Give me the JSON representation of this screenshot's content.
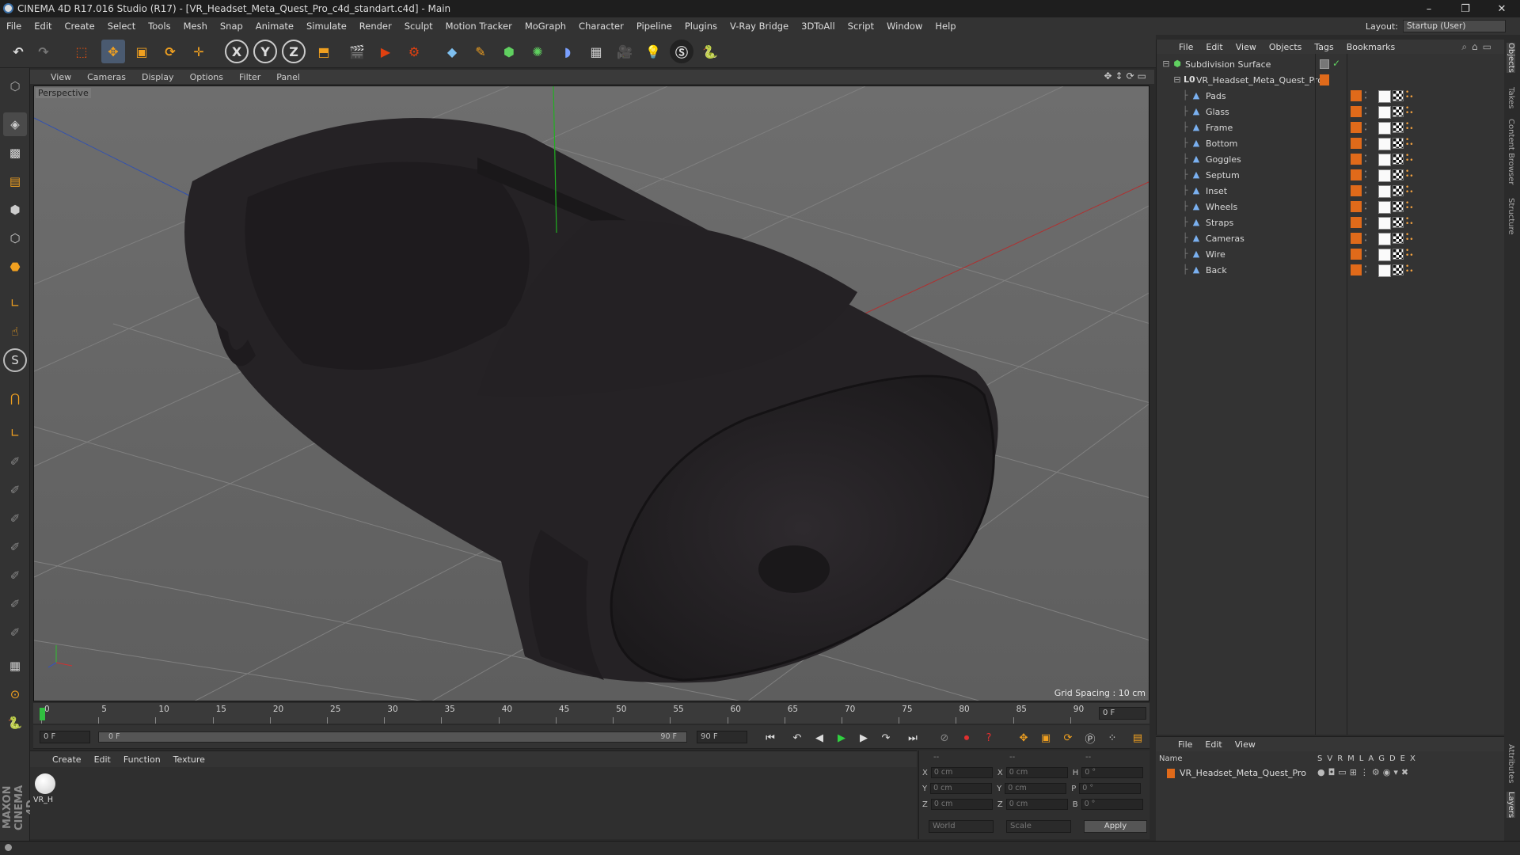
{
  "window": {
    "title": "CINEMA 4D R17.016 Studio (R17) - [VR_Headset_Meta_Quest_Pro_c4d_standart.c4d] - Main",
    "minimize": "–",
    "restore": "❐",
    "close": "✕"
  },
  "menubar": {
    "items": [
      "File",
      "Edit",
      "Create",
      "Select",
      "Tools",
      "Mesh",
      "Snap",
      "Animate",
      "Simulate",
      "Render",
      "Sculpt",
      "Motion Tracker",
      "MoGraph",
      "Character",
      "Pipeline",
      "Plugins",
      "V-Ray Bridge",
      "3DToAll",
      "Script",
      "Window",
      "Help"
    ],
    "layout_label": "Layout:",
    "layout_value": "Startup (User)"
  },
  "toolbar": {
    "axis_x": "X",
    "axis_y": "Y",
    "axis_z": "Z"
  },
  "viewport": {
    "menu": [
      "View",
      "Cameras",
      "Display",
      "Options",
      "Filter",
      "Panel"
    ],
    "label": "Perspective",
    "grid_spacing": "Grid Spacing : 10 cm",
    "nav_icons": "✥↕⟳▭"
  },
  "timeline": {
    "ticks": [
      "0",
      "5",
      "10",
      "15",
      "20",
      "25",
      "30",
      "35",
      "40",
      "45",
      "50",
      "55",
      "60",
      "65",
      "70",
      "75",
      "80",
      "85",
      "90"
    ],
    "current_frame": "0 F"
  },
  "controls": {
    "start_frame": "0 F",
    "range_start": "0 F",
    "range_end": "90 F",
    "end_frame": "90 F"
  },
  "material": {
    "menu": [
      "Create",
      "Edit",
      "Function",
      "Texture"
    ],
    "items": [
      {
        "name": "VR_H"
      }
    ]
  },
  "coords": {
    "header_a": "--",
    "header_b": "--",
    "header_c": "--",
    "rows": [
      {
        "a": "X",
        "av": "0 cm",
        "b": "X",
        "bv": "0 cm",
        "c": "H",
        "cv": "0 °"
      },
      {
        "a": "Y",
        "av": "0 cm",
        "b": "Y",
        "bv": "0 cm",
        "c": "P",
        "cv": "0 °"
      },
      {
        "a": "Z",
        "av": "0 cm",
        "b": "Z",
        "bv": "0 cm",
        "c": "B",
        "cv": "0 °"
      }
    ],
    "world": "World",
    "scale": "Scale",
    "apply": "Apply"
  },
  "objects": {
    "menu": [
      "File",
      "Edit",
      "View",
      "Objects",
      "Tags",
      "Bookmarks"
    ],
    "root": "Subdivision Surface",
    "group": "VR_Headset_Meta_Quest_Pro",
    "children": [
      "Pads",
      "Glass",
      "Frame",
      "Bottom",
      "Goggles",
      "Septum",
      "Inset",
      "Wheels",
      "Straps",
      "Cameras",
      "Wire",
      "Back"
    ]
  },
  "layers": {
    "menu": [
      "File",
      "Edit",
      "View"
    ],
    "name_header": "Name",
    "cols": [
      "S",
      "V",
      "R",
      "M",
      "L",
      "A",
      "G",
      "D",
      "E",
      "X"
    ],
    "row": "VR_Headset_Meta_Quest_Pro"
  },
  "side_tabs": [
    "Objects",
    "Takes",
    "Content Browser",
    "Structure",
    "Attributes",
    "Layers"
  ],
  "brand": "MAXON CINEMA 4D"
}
